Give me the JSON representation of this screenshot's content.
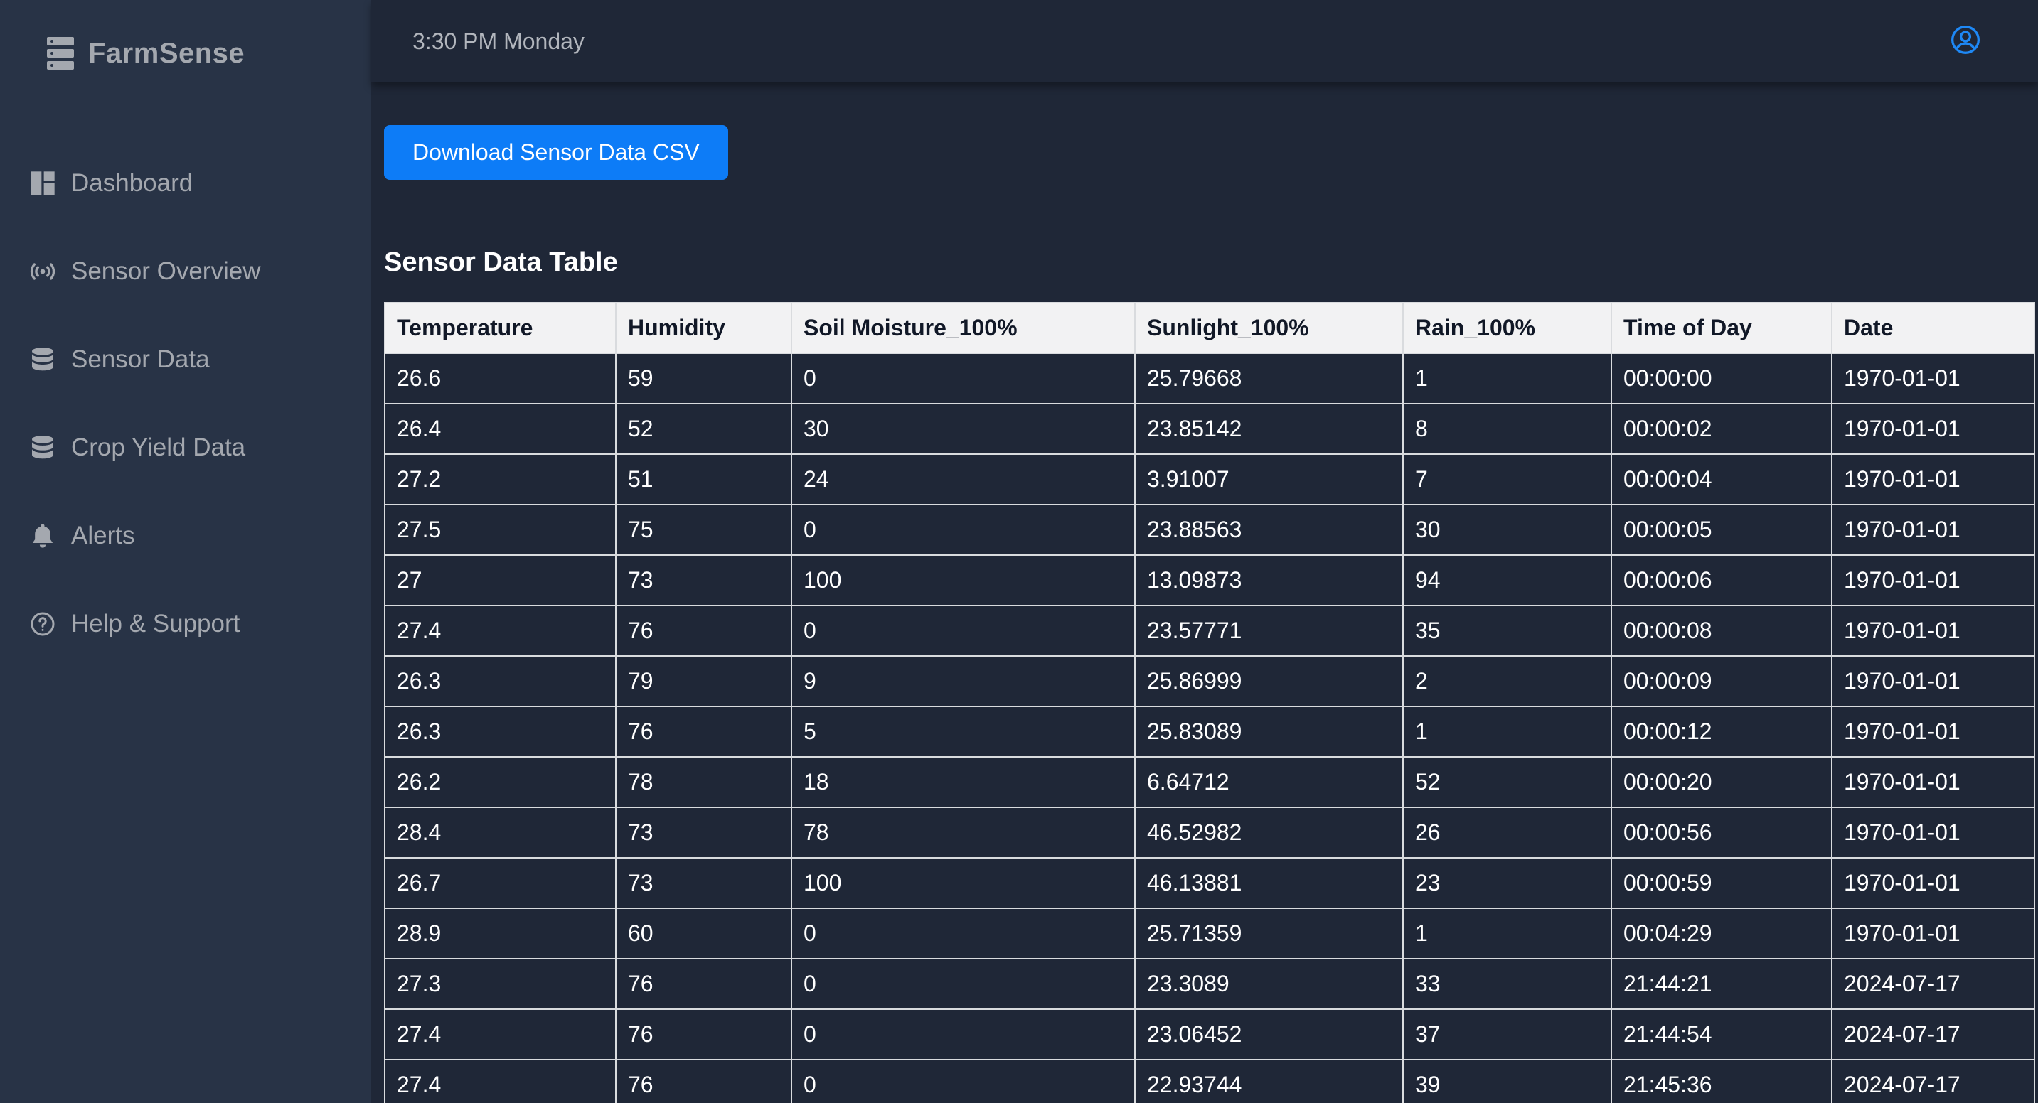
{
  "brand": {
    "name": "FarmSense",
    "icon": "server-icon"
  },
  "sidebar": {
    "items": [
      {
        "label": "Dashboard",
        "icon": "dashboard-icon"
      },
      {
        "label": "Sensor Overview",
        "icon": "broadcast-icon"
      },
      {
        "label": "Sensor Data",
        "icon": "database-icon"
      },
      {
        "label": "Crop Yield Data",
        "icon": "database-icon"
      },
      {
        "label": "Alerts",
        "icon": "bell-icon"
      },
      {
        "label": "Help & Support",
        "icon": "help-circle-icon"
      }
    ]
  },
  "header": {
    "time": "3:30 PM Monday",
    "user_icon": "user-circle-icon"
  },
  "main": {
    "download_label": "Download Sensor Data CSV",
    "table_title": "Sensor Data Table"
  },
  "table": {
    "columns": [
      "Temperature",
      "Humidity",
      "Soil Moisture_100%",
      "Sunlight_100%",
      "Rain_100%",
      "Time of Day",
      "Date"
    ],
    "rows": [
      [
        "26.6",
        "59",
        "0",
        "25.79668",
        "1",
        "00:00:00",
        "1970-01-01"
      ],
      [
        "26.4",
        "52",
        "30",
        "23.85142",
        "8",
        "00:00:02",
        "1970-01-01"
      ],
      [
        "27.2",
        "51",
        "24",
        "3.91007",
        "7",
        "00:00:04",
        "1970-01-01"
      ],
      [
        "27.5",
        "75",
        "0",
        "23.88563",
        "30",
        "00:00:05",
        "1970-01-01"
      ],
      [
        "27",
        "73",
        "100",
        "13.09873",
        "94",
        "00:00:06",
        "1970-01-01"
      ],
      [
        "27.4",
        "76",
        "0",
        "23.57771",
        "35",
        "00:00:08",
        "1970-01-01"
      ],
      [
        "26.3",
        "79",
        "9",
        "25.86999",
        "2",
        "00:00:09",
        "1970-01-01"
      ],
      [
        "26.3",
        "76",
        "5",
        "25.83089",
        "1",
        "00:00:12",
        "1970-01-01"
      ],
      [
        "26.2",
        "78",
        "18",
        "6.64712",
        "52",
        "00:00:20",
        "1970-01-01"
      ],
      [
        "28.4",
        "73",
        "78",
        "46.52982",
        "26",
        "00:00:56",
        "1970-01-01"
      ],
      [
        "26.7",
        "73",
        "100",
        "46.13881",
        "23",
        "00:00:59",
        "1970-01-01"
      ],
      [
        "28.9",
        "60",
        "0",
        "25.71359",
        "1",
        "00:04:29",
        "1970-01-01"
      ],
      [
        "27.3",
        "76",
        "0",
        "23.3089",
        "33",
        "21:44:21",
        "2024-07-17"
      ],
      [
        "27.4",
        "76",
        "0",
        "23.06452",
        "37",
        "21:44:54",
        "2024-07-17"
      ],
      [
        "27.4",
        "76",
        "0",
        "22.93744",
        "39",
        "21:45:36",
        "2024-07-17"
      ]
    ]
  },
  "colors": {
    "sidebar_bg": "#283346",
    "main_bg": "#1f2737",
    "accent": "#0d7cf7",
    "muted_text": "#a4a8af"
  }
}
